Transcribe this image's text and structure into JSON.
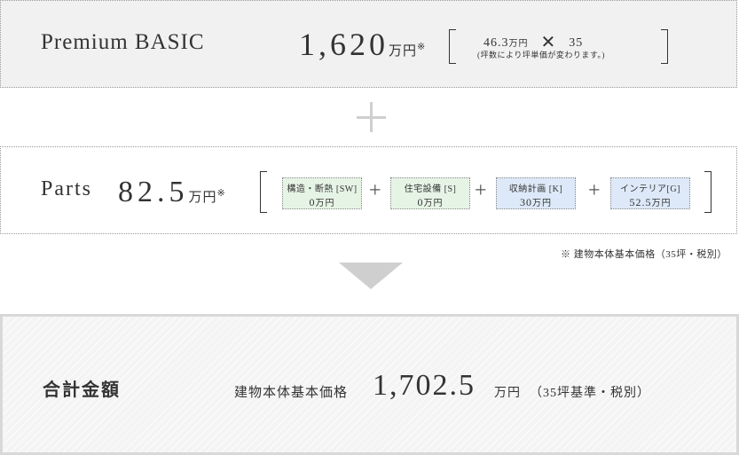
{
  "basic": {
    "title": "Premium BASIC",
    "price": "1,620",
    "unit": "万円",
    "mark": "※",
    "unit_price": "46.3",
    "unit_price_unit": "万円",
    "times_symbol": "✕",
    "tsubo": "35",
    "note": "(坪数により坪単価が変わります。)"
  },
  "parts": {
    "title": "Parts",
    "price": "82.5",
    "unit": "万円",
    "mark": "※",
    "plus_symbol": "+",
    "items": [
      {
        "name": "構造・断熱 [SW]",
        "value": "0",
        "unit": "万円",
        "color": "#e6f4e5"
      },
      {
        "name": "住宅設備 [S]",
        "value": "0",
        "unit": "万円",
        "color": "#e6f4e5"
      },
      {
        "name": "収納計画 [K]",
        "value": "30",
        "unit": "万円",
        "color": "#dde9f8"
      },
      {
        "name": "インテリア[G]",
        "value": "52.5",
        "unit": "万円",
        "color": "#dde9f8"
      }
    ]
  },
  "footnote": "※ 建物本体基本価格（35坪・税別）",
  "total": {
    "title": "合計金額",
    "label": "建物本体基本価格",
    "value": "1,702.5",
    "unit": "万円",
    "note": "（35坪基準・税別）"
  },
  "colors": {
    "basic_bg": "#f1f1f1",
    "part_green": "#e6f4e5",
    "part_blue": "#dde9f8",
    "accent_gray": "#cfcfcf"
  }
}
